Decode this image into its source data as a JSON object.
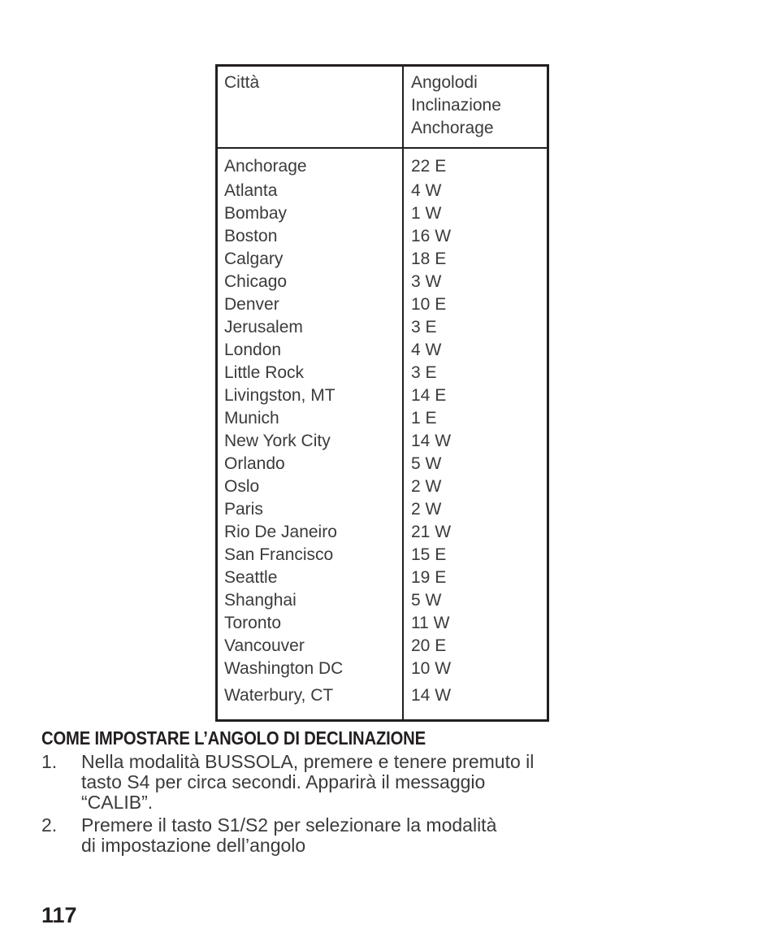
{
  "table": {
    "headers": {
      "city": "Città",
      "angle_lines": [
        "Angolodi",
        "Inclinazione",
        "Anchorage"
      ]
    },
    "rows": [
      {
        "city": "Anchorage",
        "angle": "22 E"
      },
      {
        "city": "Atlanta",
        "angle": "4 W"
      },
      {
        "city": "Bombay",
        "angle": "1 W"
      },
      {
        "city": "Boston",
        "angle": "16 W"
      },
      {
        "city": "Calgary",
        "angle": "18 E"
      },
      {
        "city": "Chicago",
        "angle": "3 W"
      },
      {
        "city": "Denver",
        "angle": "10 E"
      },
      {
        "city": "Jerusalem",
        "angle": "3 E"
      },
      {
        "city": "London",
        "angle": "4 W"
      },
      {
        "city": "Little Rock",
        "angle": "3 E"
      },
      {
        "city": "Livingston, MT",
        "angle": "14 E"
      },
      {
        "city": "Munich",
        "angle": "1 E"
      },
      {
        "city": "New York City",
        "angle": "14 W"
      },
      {
        "city": "Orlando",
        "angle": "5 W"
      },
      {
        "city": "Oslo",
        "angle": "2 W"
      },
      {
        "city": "Paris",
        "angle": "2 W"
      },
      {
        "city": "Rio De Janeiro",
        "angle": "21 W"
      },
      {
        "city": "San Francisco",
        "angle": "15 E"
      },
      {
        "city": "Seattle",
        "angle": "19 E"
      },
      {
        "city": "Shanghai",
        "angle": "5 W"
      },
      {
        "city": "Toronto",
        "angle": "11 W"
      },
      {
        "city": "Vancouver",
        "angle": "20 E"
      },
      {
        "city": "Washington DC",
        "angle": "10 W"
      },
      {
        "city": "Waterbury, CT",
        "angle": "14 W"
      }
    ]
  },
  "section": {
    "heading": "COME IMPOSTARE L’ANGOLO DI DECLINAZIONE",
    "steps": [
      {
        "number": "1.",
        "lines": [
          "Nella modalità BUSSOLA, premere e tenere premuto il",
          "tasto S4 per circa secondi. Apparirà il messaggio",
          "“CALIB”."
        ]
      },
      {
        "number": "2.",
        "lines": [
          "Premere il tasto S1/S2 per selezionare la modalità",
          "di impostazione dell’angolo"
        ]
      }
    ]
  },
  "footer": {
    "page_number": "117"
  },
  "colors": {
    "text": "#3b3b3b",
    "heading": "#231f20",
    "border": "#231f20",
    "background": "#ffffff"
  }
}
